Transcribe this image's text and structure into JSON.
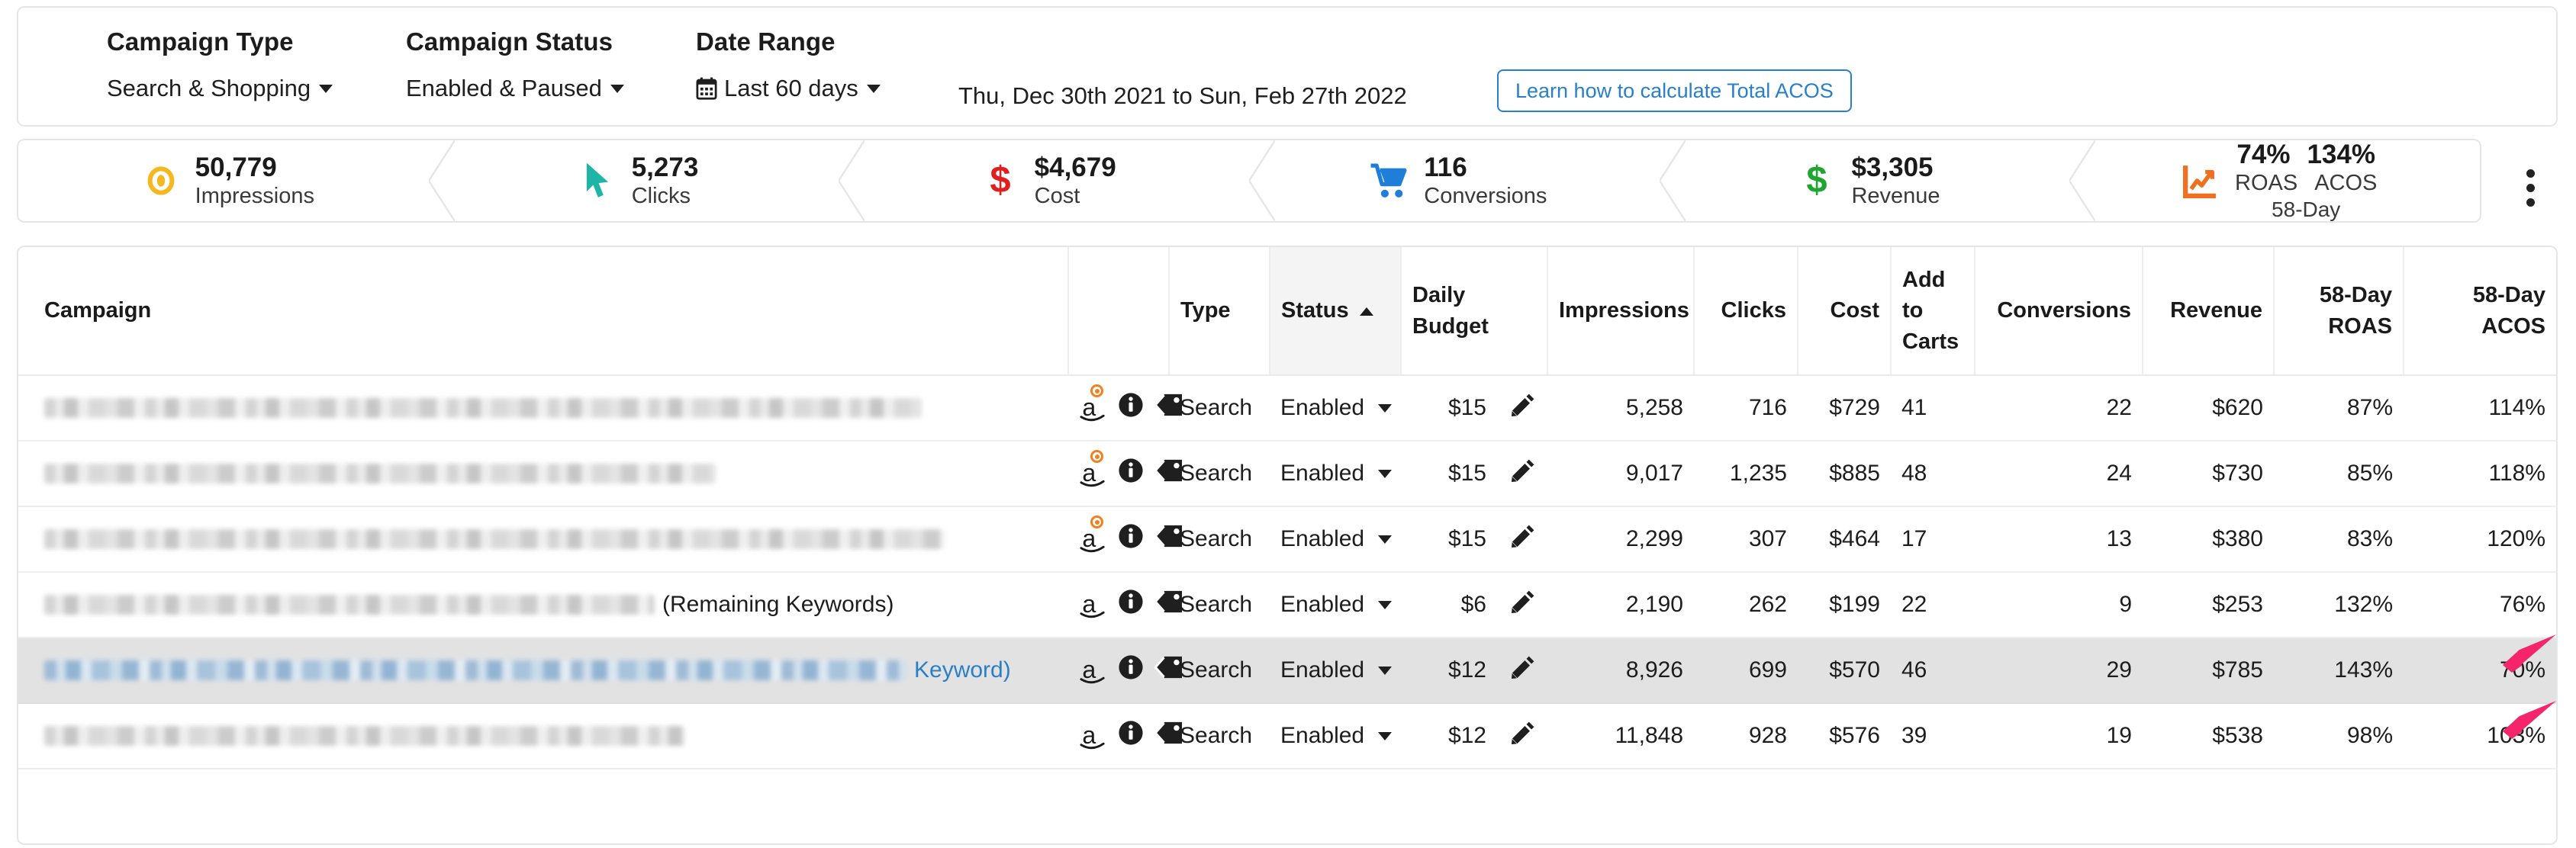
{
  "filters": {
    "campaign_type": {
      "label": "Campaign Type",
      "value": "Search & Shopping"
    },
    "campaign_status": {
      "label": "Campaign Status",
      "value": "Enabled & Paused"
    },
    "date_range": {
      "label": "Date Range",
      "value": "Last 60 days"
    },
    "date_display": "Thu, Dec 30th 2021 to Sun, Feb 27th 2022",
    "learn_button": "Learn how to calculate Total ACOS"
  },
  "kpis": [
    {
      "value": "50,779",
      "label": "Impressions",
      "icon": "eye-icon",
      "color": "#f5b91f"
    },
    {
      "value": "5,273",
      "label": "Clicks",
      "icon": "cursor-icon",
      "color": "#1fb5a6"
    },
    {
      "value": "$4,679",
      "label": "Cost",
      "icon": "dollar-icon",
      "color": "#e02020"
    },
    {
      "value": "116",
      "label": "Conversions",
      "icon": "cart-icon",
      "color": "#1f7fd8"
    },
    {
      "value": "$3,305",
      "label": "Revenue",
      "icon": "dollar-icon",
      "color": "#21a531"
    }
  ],
  "kpi_dual": {
    "icon": "trend-chart-icon",
    "color": "#f07020",
    "value_left": "74%",
    "value_right": "134%",
    "label_left": "ROAS",
    "label_right": "ACOS",
    "sublabel": "58-Day"
  },
  "overflow_menu": "kebab-menu",
  "table": {
    "columns": [
      "Campaign",
      "",
      "Type",
      "Status",
      "Daily Budget",
      "Impressions",
      "Clicks",
      "Cost",
      "Add to Carts",
      "Conversions",
      "Revenue",
      "58-Day ROAS",
      "58-Day ACOS"
    ],
    "sorted_column": "Status",
    "sort_direction": "asc",
    "rows": [
      {
        "campaign_blur_width": 1150,
        "campaign_suffix": "",
        "campaign_is_link": false,
        "has_orange_dot": true,
        "type": "Search",
        "status": "Enabled",
        "budget": "$15",
        "impressions": "5,258",
        "clicks": "716",
        "cost": "$729",
        "add_to_carts": "41",
        "conversions": "22",
        "revenue": "$620",
        "roas": "87%",
        "acos": "114%",
        "selected": false,
        "arrow": false
      },
      {
        "campaign_blur_width": 880,
        "campaign_suffix": "",
        "campaign_is_link": false,
        "has_orange_dot": true,
        "type": "Search",
        "status": "Enabled",
        "budget": "$15",
        "impressions": "9,017",
        "clicks": "1,235",
        "cost": "$885",
        "add_to_carts": "48",
        "conversions": "24",
        "revenue": "$730",
        "roas": "85%",
        "acos": "118%",
        "selected": false,
        "arrow": false
      },
      {
        "campaign_blur_width": 1180,
        "campaign_suffix": "",
        "campaign_is_link": false,
        "has_orange_dot": true,
        "type": "Search",
        "status": "Enabled",
        "budget": "$15",
        "impressions": "2,299",
        "clicks": "307",
        "cost": "$464",
        "add_to_carts": "17",
        "conversions": "13",
        "revenue": "$380",
        "roas": "83%",
        "acos": "120%",
        "selected": false,
        "arrow": false
      },
      {
        "campaign_blur_width": 800,
        "campaign_suffix": "(Remaining Keywords)",
        "campaign_is_link": false,
        "has_orange_dot": false,
        "type": "Search",
        "status": "Enabled",
        "budget": "$6",
        "impressions": "2,190",
        "clicks": "262",
        "cost": "$199",
        "add_to_carts": "22",
        "conversions": "9",
        "revenue": "$253",
        "roas": "132%",
        "acos": "76%",
        "selected": false,
        "arrow": true
      },
      {
        "campaign_blur_width": 1130,
        "campaign_suffix": "Keyword)",
        "campaign_is_link": true,
        "has_orange_dot": false,
        "type": "Search",
        "status": "Enabled",
        "budget": "$12",
        "impressions": "8,926",
        "clicks": "699",
        "cost": "$570",
        "add_to_carts": "46",
        "conversions": "29",
        "revenue": "$785",
        "roas": "143%",
        "acos": "70%",
        "selected": true,
        "arrow": true
      },
      {
        "campaign_blur_width": 840,
        "campaign_suffix": "",
        "campaign_is_link": false,
        "has_orange_dot": false,
        "type": "Search",
        "status": "Enabled",
        "budget": "$12",
        "impressions": "11,848",
        "clicks": "928",
        "cost": "$576",
        "add_to_carts": "39",
        "conversions": "19",
        "revenue": "$538",
        "roas": "98%",
        "acos": "103%",
        "selected": false,
        "arrow": false
      }
    ]
  },
  "annotation": {
    "arrow_color": "#f4256b",
    "icon": "arrow-pointer-icon"
  }
}
